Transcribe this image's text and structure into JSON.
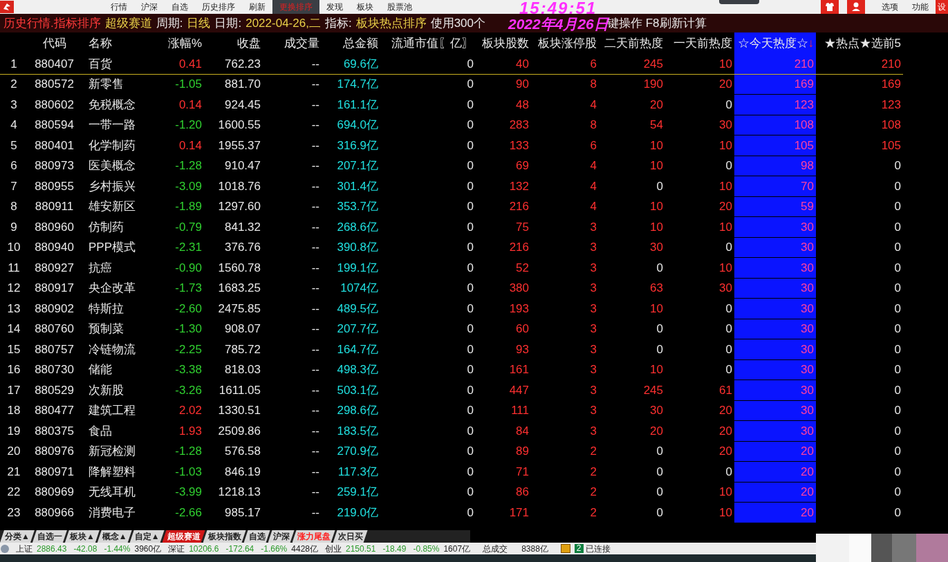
{
  "menu": [
    {
      "label": "行情",
      "selected": false
    },
    {
      "label": "沪深",
      "selected": false
    },
    {
      "label": "自选",
      "selected": false
    },
    {
      "label": "历史排序",
      "selected": false
    },
    {
      "label": "刷新",
      "selected": false
    },
    {
      "label": "更换排序",
      "selected": true
    },
    {
      "label": "发现",
      "selected": false
    },
    {
      "label": "板块",
      "selected": false
    },
    {
      "label": "股票池",
      "selected": false
    }
  ],
  "menu_right": [
    "选项",
    "功能",
    "设"
  ],
  "clock": {
    "time": "15:49:51",
    "date": "2022年4月26日"
  },
  "info_bar": [
    {
      "text": "历史行情.指标排序",
      "kind": "title"
    },
    {
      "text": "超级赛道",
      "kind": "value"
    },
    {
      "text": "周期:",
      "kind": "label"
    },
    {
      "text": "日线",
      "kind": "value"
    },
    {
      "text": "日期:",
      "kind": "label"
    },
    {
      "text": "2022-04-26,二",
      "kind": "value"
    },
    {
      "text": "指标:",
      "kind": "label"
    },
    {
      "text": "板块热点排序",
      "kind": "value"
    },
    {
      "text": "使用300个",
      "kind": "label"
    },
    {
      "text": "键操作 F8刷新计算",
      "kind": "gap"
    }
  ],
  "table": {
    "columns": [
      {
        "label": "代码",
        "sorted": false
      },
      {
        "label": "名称",
        "sorted": false
      },
      {
        "label": "涨幅%",
        "sorted": false
      },
      {
        "label": "收盘",
        "sorted": false
      },
      {
        "label": "成交量",
        "sorted": false
      },
      {
        "label": "总金额",
        "sorted": false
      },
      {
        "label": "流通市值〖亿〗",
        "sorted": false
      },
      {
        "label": "板块股数",
        "sorted": false
      },
      {
        "label": "板块涨停股",
        "sorted": false
      },
      {
        "label": "二天前热度",
        "sorted": false
      },
      {
        "label": "一天前热度",
        "sorted": false
      },
      {
        "label": "☆今天热度☆",
        "sorted": true
      },
      {
        "label": "★热点★选前5",
        "sorted": false
      }
    ],
    "sort_mark": "↓",
    "rows": [
      {
        "number": "1",
        "selected": true,
        "cells": [
          "880407",
          "百货",
          "0.41",
          "762.23",
          "--",
          "69.6亿",
          "0",
          "40",
          "6",
          "245",
          "10",
          "210",
          "210"
        ]
      },
      {
        "number": "2",
        "selected": false,
        "cells": [
          "880572",
          "新零售",
          "-1.05",
          "881.70",
          "--",
          "174.7亿",
          "0",
          "90",
          "8",
          "190",
          "20",
          "169",
          "169"
        ]
      },
      {
        "number": "3",
        "selected": false,
        "cells": [
          "880602",
          "免税概念",
          "0.14",
          "924.45",
          "--",
          "161.1亿",
          "0",
          "48",
          "4",
          "20",
          "0",
          "123",
          "123"
        ]
      },
      {
        "number": "4",
        "selected": false,
        "cells": [
          "880594",
          "一带一路",
          "-1.20",
          "1600.55",
          "--",
          "694.0亿",
          "0",
          "283",
          "8",
          "54",
          "30",
          "108",
          "108"
        ]
      },
      {
        "number": "5",
        "selected": false,
        "cells": [
          "880401",
          "化学制药",
          "0.14",
          "1955.37",
          "--",
          "316.9亿",
          "0",
          "133",
          "6",
          "10",
          "10",
          "105",
          "105"
        ]
      },
      {
        "number": "6",
        "selected": false,
        "cells": [
          "880973",
          "医美概念",
          "-1.28",
          "910.47",
          "--",
          "207.1亿",
          "0",
          "69",
          "4",
          "10",
          "0",
          "98",
          "0"
        ]
      },
      {
        "number": "7",
        "selected": false,
        "cells": [
          "880955",
          "乡村振兴",
          "-3.09",
          "1018.76",
          "--",
          "301.4亿",
          "0",
          "132",
          "4",
          "0",
          "10",
          "70",
          "0"
        ]
      },
      {
        "number": "8",
        "selected": false,
        "cells": [
          "880911",
          "雄安新区",
          "-1.89",
          "1297.60",
          "--",
          "353.7亿",
          "0",
          "216",
          "4",
          "10",
          "20",
          "59",
          "0"
        ]
      },
      {
        "number": "9",
        "selected": false,
        "cells": [
          "880960",
          "仿制药",
          "-0.79",
          "841.32",
          "--",
          "268.6亿",
          "0",
          "75",
          "3",
          "10",
          "10",
          "30",
          "0"
        ]
      },
      {
        "number": "10",
        "selected": false,
        "cells": [
          "880940",
          "PPP模式",
          "-2.31",
          "376.76",
          "--",
          "390.8亿",
          "0",
          "216",
          "3",
          "30",
          "0",
          "30",
          "0"
        ]
      },
      {
        "number": "11",
        "selected": false,
        "cells": [
          "880927",
          "抗癌",
          "-0.90",
          "1560.78",
          "--",
          "199.1亿",
          "0",
          "52",
          "3",
          "0",
          "10",
          "30",
          "0"
        ]
      },
      {
        "number": "12",
        "selected": false,
        "cells": [
          "880917",
          "央企改革",
          "-1.73",
          "1683.25",
          "--",
          "1074亿",
          "0",
          "380",
          "3",
          "63",
          "30",
          "30",
          "0"
        ]
      },
      {
        "number": "13",
        "selected": false,
        "cells": [
          "880902",
          "特斯拉",
          "-2.60",
          "2475.85",
          "--",
          "489.5亿",
          "0",
          "193",
          "3",
          "10",
          "0",
          "30",
          "0"
        ]
      },
      {
        "number": "14",
        "selected": false,
        "cells": [
          "880760",
          "预制菜",
          "-1.30",
          "908.07",
          "--",
          "207.7亿",
          "0",
          "60",
          "3",
          "0",
          "0",
          "30",
          "0"
        ]
      },
      {
        "number": "15",
        "selected": false,
        "cells": [
          "880757",
          "冷链物流",
          "-2.25",
          "785.72",
          "--",
          "164.7亿",
          "0",
          "93",
          "3",
          "0",
          "0",
          "30",
          "0"
        ]
      },
      {
        "number": "16",
        "selected": false,
        "cells": [
          "880730",
          "储能",
          "-3.38",
          "818.03",
          "--",
          "498.3亿",
          "0",
          "161",
          "3",
          "10",
          "0",
          "30",
          "0"
        ]
      },
      {
        "number": "17",
        "selected": false,
        "cells": [
          "880529",
          "次新股",
          "-3.26",
          "1611.05",
          "--",
          "503.1亿",
          "0",
          "447",
          "3",
          "245",
          "61",
          "30",
          "0"
        ]
      },
      {
        "number": "18",
        "selected": false,
        "cells": [
          "880477",
          "建筑工程",
          "2.02",
          "1330.51",
          "--",
          "298.6亿",
          "0",
          "111",
          "3",
          "30",
          "20",
          "30",
          "0"
        ]
      },
      {
        "number": "19",
        "selected": false,
        "cells": [
          "880375",
          "食品",
          "1.93",
          "2509.86",
          "--",
          "183.5亿",
          "0",
          "84",
          "3",
          "20",
          "20",
          "30",
          "0"
        ]
      },
      {
        "number": "20",
        "selected": false,
        "cells": [
          "880976",
          "新冠检测",
          "-1.28",
          "576.58",
          "--",
          "270.9亿",
          "0",
          "89",
          "2",
          "0",
          "20",
          "20",
          "0"
        ]
      },
      {
        "number": "21",
        "selected": false,
        "cells": [
          "880971",
          "降解塑料",
          "-1.03",
          "846.19",
          "--",
          "117.3亿",
          "0",
          "71",
          "2",
          "0",
          "0",
          "20",
          "0"
        ]
      },
      {
        "number": "22",
        "selected": false,
        "cells": [
          "880969",
          "无线耳机",
          "-3.99",
          "1218.13",
          "--",
          "259.1亿",
          "0",
          "86",
          "2",
          "0",
          "10",
          "20",
          "0"
        ]
      },
      {
        "number": "23",
        "selected": false,
        "cells": [
          "880966",
          "消费电子",
          "-2.66",
          "985.17",
          "--",
          "219.0亿",
          "0",
          "171",
          "2",
          "0",
          "10",
          "20",
          "0"
        ]
      }
    ]
  },
  "bottom_tabs": [
    {
      "label": "分类▲",
      "selected": false
    },
    {
      "label": "自选一",
      "selected": false
    },
    {
      "label": "板块▲",
      "selected": false
    },
    {
      "label": "概念▲",
      "selected": false
    },
    {
      "label": "自定▲",
      "selected": false
    },
    {
      "label": "超级赛道",
      "selected": true
    },
    {
      "label": "板块指数",
      "selected": false
    },
    {
      "label": "自选",
      "selected": false
    },
    {
      "label": "沪深",
      "selected": false
    },
    {
      "label": "涨力尾盘",
      "selected": false,
      "color": "#ff2020"
    },
    {
      "label": "次日买",
      "selected": false
    }
  ],
  "status_bar": {
    "indices": [
      {
        "name": "上证",
        "value": "2886.43",
        "change": "-42.08",
        "pct": "-1.44%",
        "amount": "3960亿"
      },
      {
        "name": "深证",
        "value": "10206.6",
        "change": "-172.64",
        "pct": "-1.66%",
        "amount": "4428亿"
      },
      {
        "name": "创业",
        "value": "2150.51",
        "change": "-18.49",
        "pct": "-0.85%",
        "amount": "1607亿"
      }
    ],
    "total_label": "总成交",
    "total": "8388亿",
    "connection_count": "2",
    "connection": "已连接"
  }
}
